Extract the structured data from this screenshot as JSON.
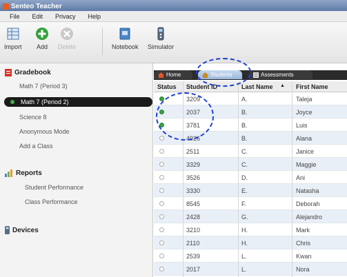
{
  "app": {
    "title": "Senteo Teacher"
  },
  "menu": [
    "File",
    "Edit",
    "Privacy",
    "Help"
  ],
  "toolbar": {
    "import_label": "Import",
    "add_label": "Add",
    "delete_label": "Delete",
    "notebook_label": "Notebook",
    "simulator_label": "Simulator"
  },
  "sidebar": {
    "gradebook_title": "Gradebook",
    "classes": [
      {
        "label": "Math 7 (Period 3)"
      },
      {
        "label": "Math 7 (Period 2)"
      },
      {
        "label": "Science 8"
      },
      {
        "label": "Anonymous Mode"
      },
      {
        "label": "Add a Class"
      }
    ],
    "reports_title": "Reports",
    "reports": [
      {
        "label": "Student Performance"
      },
      {
        "label": "Class Performance"
      }
    ],
    "devices_title": "Devices"
  },
  "tabs": {
    "home": "Home",
    "students": "Students",
    "assessments": "Assessments"
  },
  "table": {
    "columns": [
      "Status",
      "Student ID",
      "Last Name",
      "First Name"
    ],
    "rows": [
      {
        "status": "active",
        "id": "3209",
        "last": "A.",
        "first": "Taleja"
      },
      {
        "status": "active",
        "id": "2037",
        "last": "B.",
        "first": "Joyce"
      },
      {
        "status": "active",
        "id": "3781",
        "last": "B.",
        "first": "Luis"
      },
      {
        "status": "inactive",
        "id": "4926",
        "last": "B.",
        "first": "Alana"
      },
      {
        "status": "inactive",
        "id": "2511",
        "last": "C.",
        "first": "Janice"
      },
      {
        "status": "inactive",
        "id": "3329",
        "last": "C.",
        "first": "Maggie"
      },
      {
        "status": "inactive",
        "id": "3526",
        "last": "D.",
        "first": "Ani"
      },
      {
        "status": "inactive",
        "id": "3330",
        "last": "E.",
        "first": "Natasha"
      },
      {
        "status": "inactive",
        "id": "8545",
        "last": "F.",
        "first": "Deborah"
      },
      {
        "status": "inactive",
        "id": "2428",
        "last": "G.",
        "first": "Alejandro"
      },
      {
        "status": "inactive",
        "id": "3210",
        "last": "H.",
        "first": "Mark"
      },
      {
        "status": "inactive",
        "id": "2110",
        "last": "H.",
        "first": "Chris"
      },
      {
        "status": "inactive",
        "id": "2539",
        "last": "L.",
        "first": "Kwan"
      },
      {
        "status": "inactive",
        "id": "2017",
        "last": "L.",
        "first": "Nora"
      }
    ]
  },
  "colors": {
    "accent": "#1d3fd6",
    "status_on": "#3ba443",
    "selected_bg": "#1b1b1b"
  }
}
